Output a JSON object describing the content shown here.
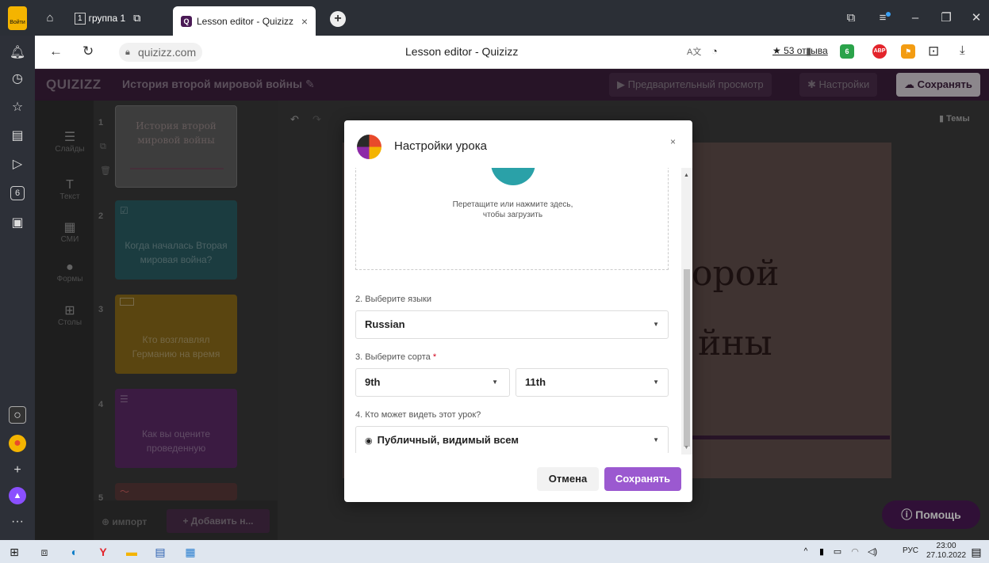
{
  "browser": {
    "login_label": "Войти",
    "tab_group_count": "1",
    "tab_group_label": "группа 1",
    "active_tab_title": "Lesson editor - Quizizz",
    "active_tab_favicon": "Q",
    "url": "quizizz.com",
    "page_title": "Lesson editor - Quizizz",
    "reviews": "★ 53 отзыва",
    "ext_abp": "ABP",
    "ext_badge": "6",
    "sidebar_badge": "6"
  },
  "app": {
    "logo": "QUIZIZZ",
    "lesson_title": "История второй мировой войны",
    "preview_label": "▶ Предварительный просмотр",
    "settings_label": "✱ Настройки",
    "save_label": "☁ Сохранять",
    "themes_label": "Темы",
    "tools": [
      {
        "label": "Слайды",
        "icon": "slides-icon"
      },
      {
        "label": "Текст",
        "icon": "text-icon"
      },
      {
        "label": "СМИ",
        "icon": "media-icon"
      },
      {
        "label": "Формы",
        "icon": "shapes-icon"
      },
      {
        "label": "Столы",
        "icon": "tables-icon"
      }
    ],
    "slides": [
      {
        "num": "1",
        "text": "История второй мировой войны"
      },
      {
        "num": "2",
        "text": "Когда началась Вторая мировая война?"
      },
      {
        "num": "3",
        "text": "Кто возглавлял Германию на время"
      },
      {
        "num": "4",
        "text": "Как вы оцените проведенную"
      },
      {
        "num": "5",
        "text": ""
      }
    ],
    "canvas_line1": "орой",
    "canvas_line2": "йны",
    "import_label": "⊕ импорт",
    "add_label": "+ Добавить н...",
    "help_label": "Помощь"
  },
  "modal": {
    "title": "Настройки урока",
    "close": "×",
    "drop_text_1": "Перетащите или нажмите здесь,",
    "drop_text_2": "чтобы загрузить",
    "lang_label": "2. Выберите языки",
    "lang_value": "Russian",
    "grade_label": "3. Выберите сорта",
    "grade_from": "9th",
    "grade_to": "11th",
    "visibility_label": "4. Кто может видеть этот урок?",
    "visibility_value": "Публичный, видимый всем",
    "cancel_label": "Отмена",
    "save_label": "Сохранять"
  },
  "taskbar": {
    "lang": "РУС",
    "time": "23:00",
    "date": "27.10.2022"
  },
  "colors": {
    "accent": "#9b59d0",
    "header": "#3c1f3d",
    "slide2": "#2a5d63",
    "slide3": "#8a6a1a",
    "slide4": "#5b2a66"
  }
}
